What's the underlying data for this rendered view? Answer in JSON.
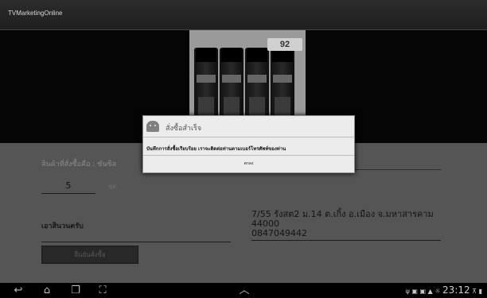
{
  "app": {
    "title": "TVMarketingOnline"
  },
  "product": {
    "price_tag": "92"
  },
  "form": {
    "product_label": "สินค้าที่สั่งซื้อคือ : ซันซิล",
    "quantity_value": "5",
    "unit_label": "ชุด",
    "receive_label": "เอาสินวนตรับ",
    "address_lines": [
      "7/55 รังสต2 ม.14 ต.เกิ้ง อ.เมือง จ.มหาสารคาม",
      "44000",
      "0847049442"
    ],
    "confirm_button_label": "ยืนยันสั่งซื้อ"
  },
  "dialog": {
    "title": "สั่งซื้อสำเร็จ",
    "message": "บันทึกการสั่งซื้อเรียบร้อย เราจะติดต่อท่านตามเบอร์โทรศัพท์ของท่าน",
    "ok_label": "ตกลง"
  },
  "nav": {
    "back_icon": "back-icon",
    "home_icon": "home-icon",
    "recents_icon": "recents-icon",
    "screenshot_icon": "screenshot-icon",
    "up_icon": "chevron-up-icon"
  },
  "status": {
    "icons": "ψ ▣ ▣ ▲ ☼",
    "time": "23:12",
    "signal": "⊼ ▮"
  },
  "colors": {
    "dialog_bg": "#ececec",
    "action_bar": "#2a2a2a",
    "form_bg": "#555555"
  }
}
